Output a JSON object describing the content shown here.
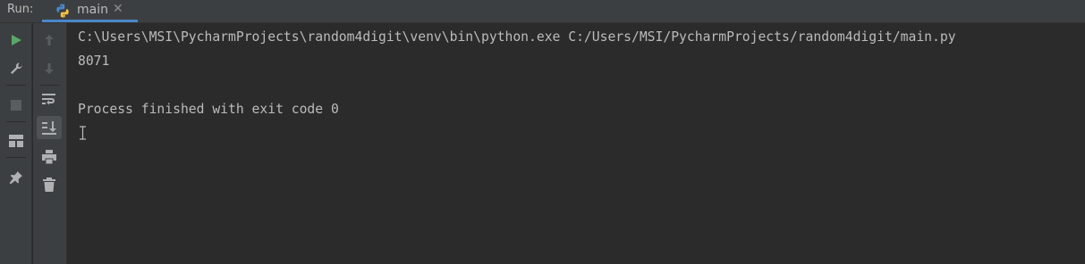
{
  "run_panel": {
    "label": "Run:",
    "tab": {
      "label": "main",
      "close": "✕",
      "icon": "python-icon"
    }
  },
  "left_toolbar": [
    {
      "name": "run-icon",
      "color": "#59a869"
    },
    {
      "name": "wrench-icon"
    },
    {
      "name": "stop-icon",
      "disabled": true
    },
    {
      "name": "layout-icon"
    },
    {
      "name": "pin-icon"
    }
  ],
  "second_toolbar": [
    {
      "name": "up-arrow-icon",
      "disabled": true
    },
    {
      "name": "down-arrow-icon",
      "disabled": true
    },
    {
      "name": "soft-wrap-icon"
    },
    {
      "name": "scroll-to-end-icon",
      "active": true
    },
    {
      "name": "print-icon"
    },
    {
      "name": "trash-icon"
    }
  ],
  "console": {
    "lines": [
      "C:\\Users\\MSI\\PycharmProjects\\random4digit\\venv\\bin\\python.exe C:/Users/MSI/PycharmProjects/random4digit/main.py",
      "8071",
      "",
      "Process finished with exit code 0"
    ]
  },
  "colors": {
    "background": "#2b2b2b",
    "panel": "#3c3f41",
    "text": "#bbbbbb",
    "accent": "#4a88c7"
  }
}
